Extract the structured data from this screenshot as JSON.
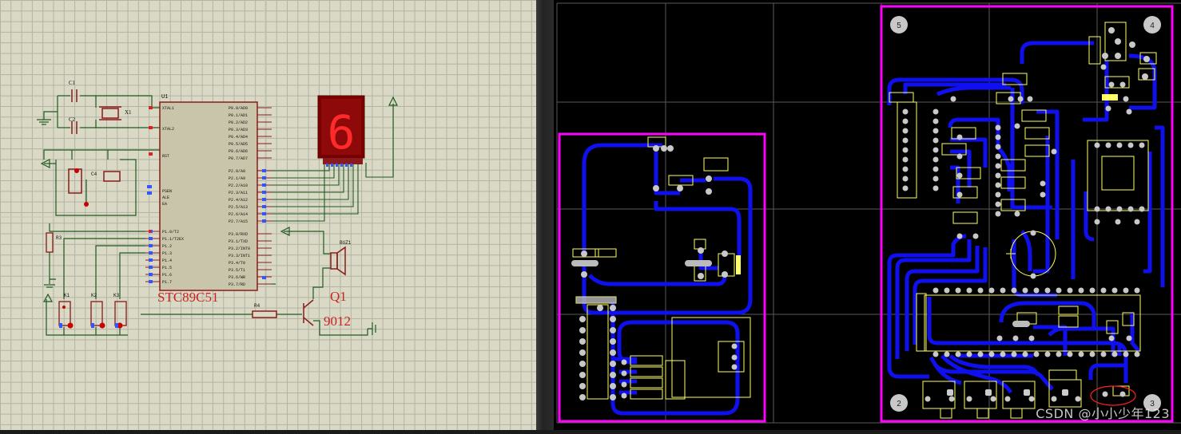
{
  "schematic": {
    "mcu_label": "STC89C51",
    "mcu_ref": "U1",
    "transistor_ref": "Q1",
    "transistor_part": "9012",
    "crystal_ref": "X1",
    "c1_ref": "C1",
    "c2_ref": "C2",
    "c4_ref": "C4",
    "r3_ref": "R3",
    "r4_ref": "R4",
    "buzzer_ref": "BUZ1",
    "display_digit": "6",
    "k_labels": [
      "K1",
      "K2",
      "K3"
    ]
  },
  "pcb": {
    "hole_labels": [
      "5",
      "4",
      "2",
      "3"
    ]
  },
  "watermark": "CSDN @小小少年123",
  "colors": {
    "schematic_bg": "#d9d9c6",
    "wire": "#1f5a1f",
    "component": "#8b1a1a",
    "pcb_bg": "#000000",
    "track": "#1010ee",
    "outline": "#ff00ff",
    "silkscreen": "#ffff66"
  }
}
